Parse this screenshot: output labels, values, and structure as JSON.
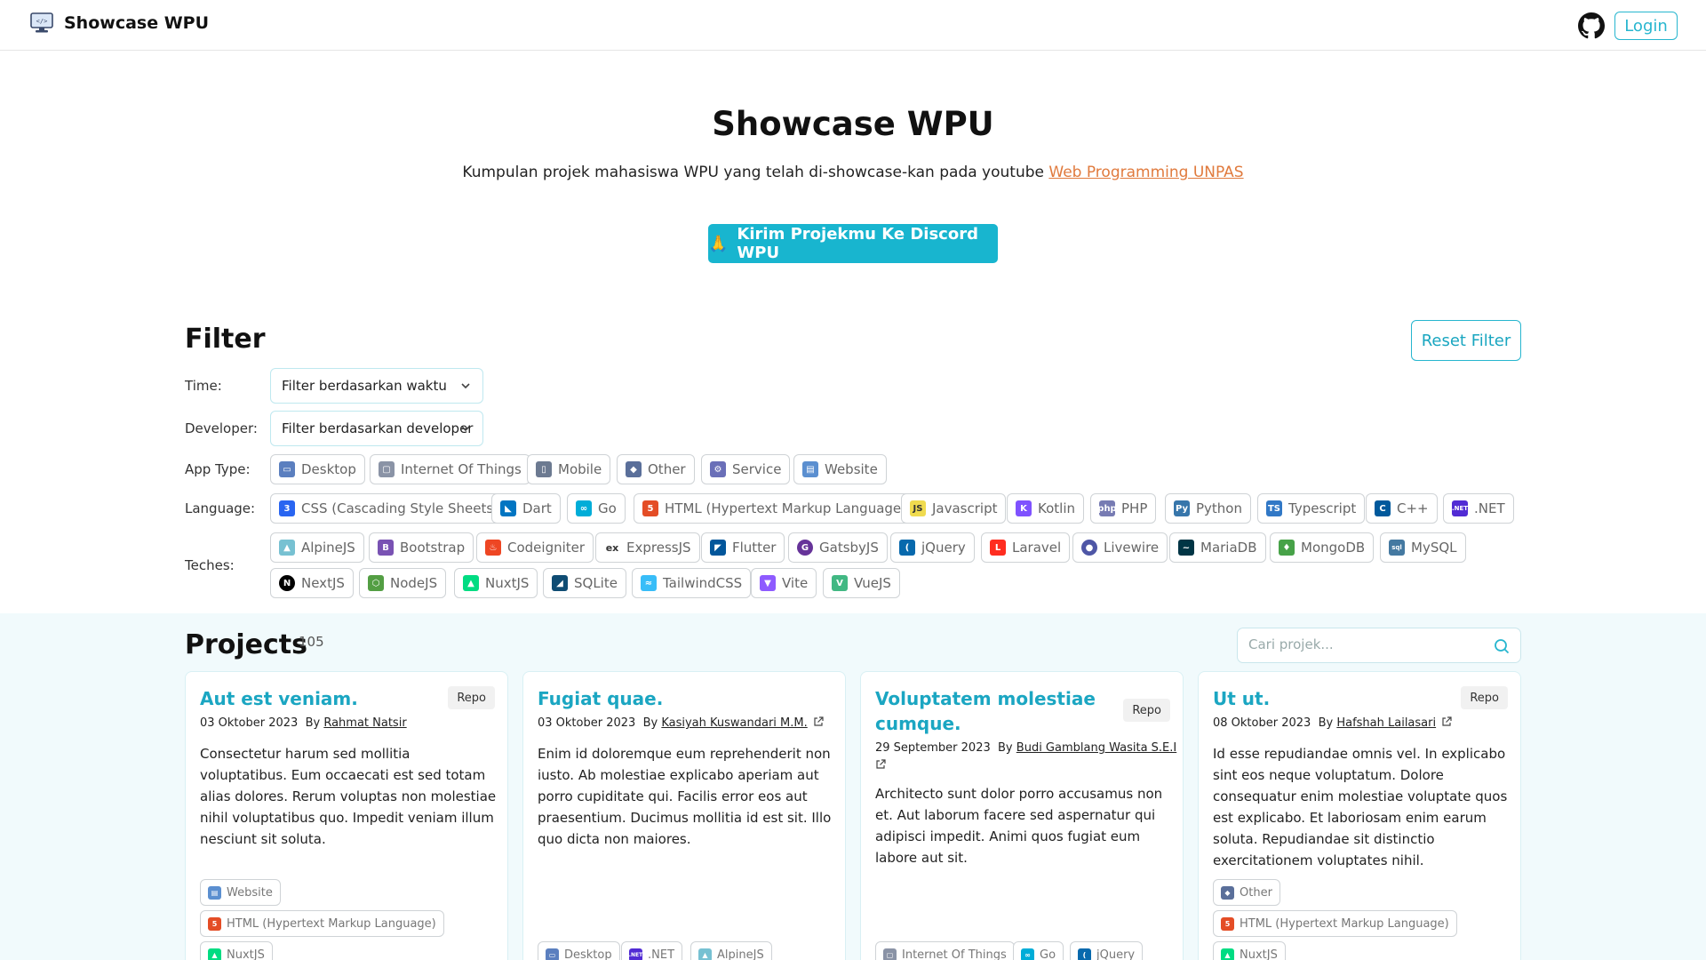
{
  "navbar": {
    "brand": "Showcase WPU",
    "login_label": "Login"
  },
  "hero": {
    "title": "Showcase WPU",
    "subtitle": "Kumpulan projek mahasiswa WPU yang telah di-showcase-kan pada youtube ",
    "subtitle_link": "Web Programming UNPAS",
    "cta_emoji": "🙏",
    "cta_label": "Kirim Projekmu Ke Discord WPU"
  },
  "filter": {
    "title": "Filter",
    "reset_label": "Reset Filter",
    "time_label": "Time:",
    "time_value": "Filter berdasarkan waktu",
    "developer_label": "Developer:",
    "developer_value": "Filter berdasarkan developer",
    "app_type_label": "App Type:",
    "language_label": "Language:",
    "teches_label": "Teches:",
    "app_types": [
      "Desktop",
      "Internet Of Things",
      "Mobile",
      "Other",
      "Service",
      "Website"
    ],
    "languages": [
      "CSS (Cascading Style Sheets)",
      "Dart",
      "Go",
      "HTML (Hypertext Markup Language)",
      "Javascript",
      "Kotlin",
      "PHP",
      "Python",
      "Typescript",
      "C++",
      ".NET"
    ],
    "teches_row1": [
      "AlpineJS",
      "Bootstrap",
      "Codeigniter",
      "ExpressJS",
      "Flutter",
      "GatsbyJS",
      "jQuery",
      "Laravel",
      "Livewire",
      "MariaDB",
      "MongoDB",
      "MySQL"
    ],
    "teches_row2": [
      "NextJS",
      "NodeJS",
      "NuxtJS",
      "SQLite",
      "TailwindCSS",
      "Vite",
      "VueJS"
    ]
  },
  "projects": {
    "title": "Projects",
    "count": "105",
    "search_placeholder": "Cari projek...",
    "repo_label": "Repo",
    "by_label": "By",
    "cards": [
      {
        "title": "Aut est veniam.",
        "date": "03 Oktober 2023",
        "author": "Rahmat Natsir",
        "description": "Consectetur harum sed mollitia voluptatibus. Eum occaecati est sed totam alias dolores. Rerum voluptas non molestiae nihil voluptatibus quo. Impedit veniam illum nesciunt sit soluta.",
        "tags": [
          "Website",
          "HTML (Hypertext Markup Language)",
          "NuxtJS"
        ]
      },
      {
        "title": "Fugiat quae.",
        "date": "03 Oktober 2023",
        "author": "Kasiyah Kuswandari M.M.",
        "description": "Enim id doloremque eum reprehenderit non iusto. Ab molestiae explicabo aperiam aut porro cupiditate qui. Facilis error eos aut praesentium. Ducimus mollitia id est sit. Illo quo dicta non maiores.",
        "tags": [
          "Desktop",
          ".NET",
          "AlpineJS"
        ]
      },
      {
        "title": "Voluptatem molestiae cumque.",
        "date": "29 September 2023",
        "author": "Budi Gamblang Wasita S.E.I",
        "description": "Architecto sunt dolor porro accusamus non et. Aut laborum facere sed aspernatur qui adipisci impedit. Animi quos fugiat eum labore aut sit.",
        "tags": [
          "Internet Of Things",
          "Go",
          "jQuery"
        ]
      },
      {
        "title": "Ut ut.",
        "date": "08 Oktober 2023",
        "author": "Hafshah Lailasari",
        "description": "Id esse repudiandae omnis vel. In explicabo sint eos neque voluptatum. Dolore consequatur enim molestiae voluptate quos est explicabo. Et laboriosam enim earum soluta. Repudiandae sit distinctio exercitationem voluptates nihil.",
        "tags": [
          "Other",
          "HTML (Hypertext Markup Language)",
          "NuxtJS"
        ]
      }
    ]
  },
  "colors": {
    "accent": "#18b5cf",
    "link": "#e07a3d",
    "title_blue": "#1ba6c2"
  }
}
